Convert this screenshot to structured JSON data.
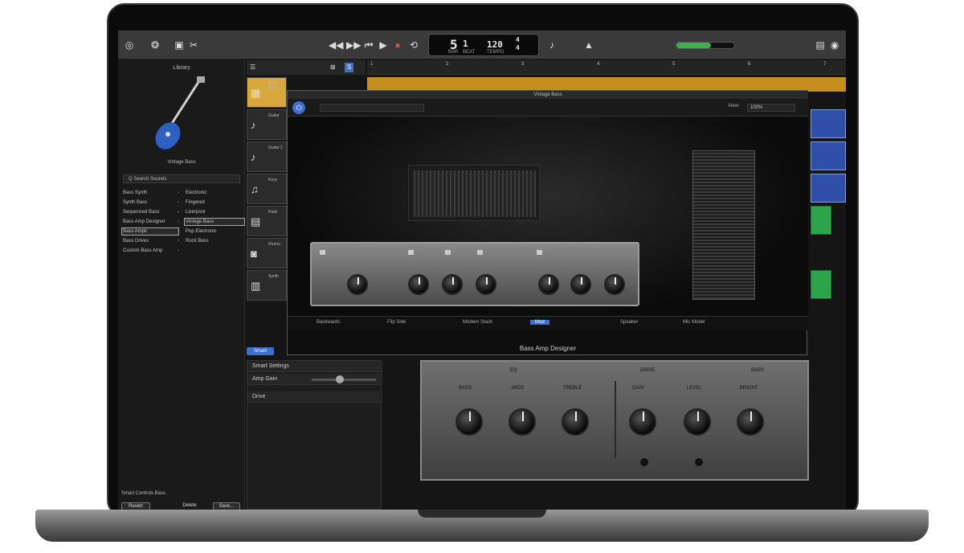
{
  "control_bar": {
    "bar": "5",
    "beat": "1",
    "bar_label": "BAR",
    "beat_label": "BEAT",
    "tempo": "120",
    "tempo_label": "TEMPO",
    "sig_top": "4",
    "sig_bottom": "4",
    "meter_color": "#3bb14a"
  },
  "library": {
    "title": "Library",
    "preset_name": "Vintage Bass",
    "search_placeholder": "Q  Search Sounds",
    "rows": [
      {
        "c1": "Bass Synth",
        "c2": "Electronic"
      },
      {
        "c1": "Synth Bass",
        "c2": "Fingered"
      },
      {
        "c1": "Sequenced Bass",
        "c2": "Liverpool"
      },
      {
        "c1": "Bass Amp Designer",
        "c2": "Vintage Bass"
      },
      {
        "c1": "Bass Ampli",
        "c2": "Pop Electronic"
      },
      {
        "c1": "Bass Drives",
        "c2": "Rock Bass"
      },
      {
        "c1": "Custom Bass Amp",
        "c2": ""
      }
    ],
    "footer_label": "Smart Controls Bass",
    "btn_revert": "Revert",
    "btn_delete": "Delete",
    "btn_save": "Save..."
  },
  "tracks": {
    "header_left": "☰",
    "header_right": "S",
    "items": [
      {
        "name": "Bass Amp"
      },
      {
        "name": "Guitar"
      },
      {
        "name": "Guitar 2"
      },
      {
        "name": "Keys"
      },
      {
        "name": "Pads"
      },
      {
        "name": "Drums"
      },
      {
        "name": "Synth"
      }
    ],
    "smart_controls_btn": "Smart"
  },
  "ruler": {
    "ticks": [
      "1",
      "2",
      "3",
      "4",
      "5",
      "6",
      "7",
      "8",
      "9"
    ]
  },
  "plugin": {
    "window_title": "Vintage Bass",
    "view_label": "View:",
    "view_value": "100%",
    "bottom_items": [
      "Backwards",
      "Flip Side",
      "Modern Stack",
      "Mod",
      "Speaker",
      "Mic Model"
    ],
    "bottom_active_index": 3,
    "name": "Bass Amp Designer"
  },
  "smart": {
    "row1": "Smart Settings",
    "row2": "Amp Gain",
    "row3": "Drive",
    "amp_labels": [
      "BASS",
      "MIDS",
      "TREBLE",
      "GAIN",
      "LEVEL",
      "BRIGHT"
    ],
    "section_left": "EQ",
    "section_right": "DRIVE",
    "section_far": "BASS"
  }
}
